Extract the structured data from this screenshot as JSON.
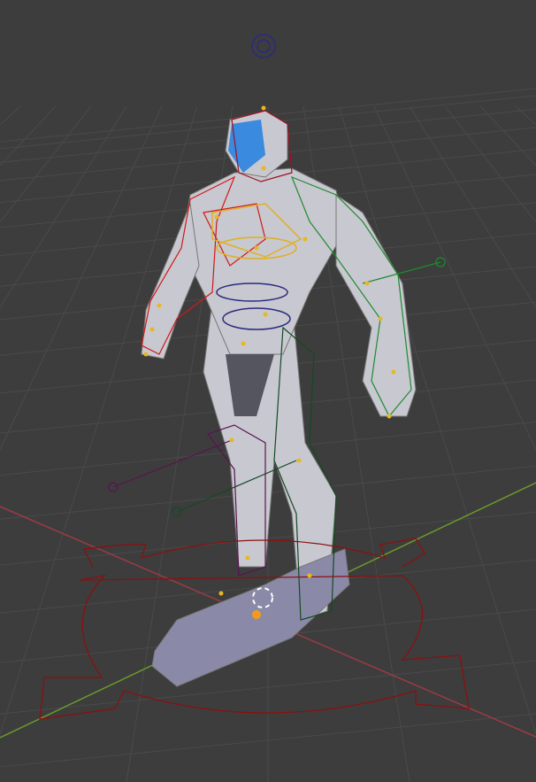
{
  "viewport": {
    "background": "#3d3d3d",
    "grid_color": "#4a4a4a",
    "x_axis_color": "#9a3b45",
    "y_axis_color": "#6c9a2a"
  },
  "rig": {
    "left_side_color": "#d01818",
    "right_side_color": "#1f8a2e",
    "center_color": "#2a2a80",
    "spine_color": "#e0b020",
    "root_control_color": "#8a1010",
    "leg_right_color": "#144a20",
    "leg_left_color": "#5a1450",
    "joint_color": "#e8b820"
  },
  "model": {
    "body_color": "#c8c8d0",
    "dark_color": "#555560",
    "visor_color": "#3a8ae0"
  }
}
